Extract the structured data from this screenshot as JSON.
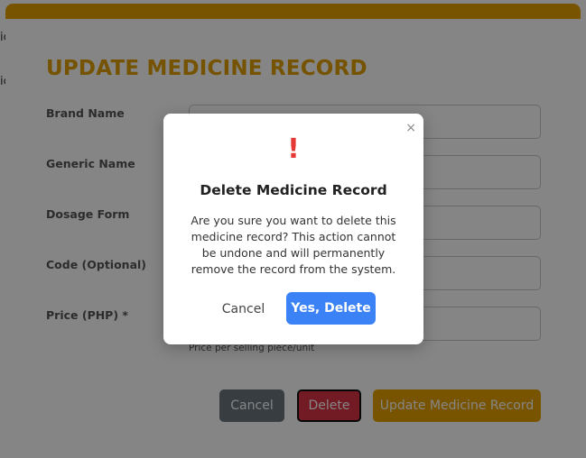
{
  "background": {
    "fragments": [
      "ic",
      "ic"
    ]
  },
  "form": {
    "title": "UPDATE MEDICINE RECORD",
    "fields": [
      {
        "label": "Brand Name",
        "value": ""
      },
      {
        "label": "Generic Name",
        "value": ""
      },
      {
        "label": "Dosage Form",
        "value": ""
      },
      {
        "label": "Code (Optional)",
        "value": ""
      },
      {
        "label": "Price (PHP) *",
        "value": ""
      }
    ],
    "price_hint": "Price per selling piece/unit",
    "buttons": {
      "cancel": "Cancel",
      "delete": "Delete",
      "update": "Update Medicine Record"
    }
  },
  "dialog": {
    "close": "×",
    "icon": "exclamation-icon",
    "icon_glyph": "!",
    "title": "Delete Medicine Record",
    "message": "Are you sure you want to delete this medicine record? This action cannot be undone and will permanently remove the record from the system.",
    "cancel": "Cancel",
    "confirm": "Yes, Delete"
  },
  "colors": {
    "accent": "#e8a200",
    "danger": "#dc3545",
    "primary": "#3b82f6",
    "secondary": "#6c757d",
    "warning_icon": "#e53935"
  }
}
